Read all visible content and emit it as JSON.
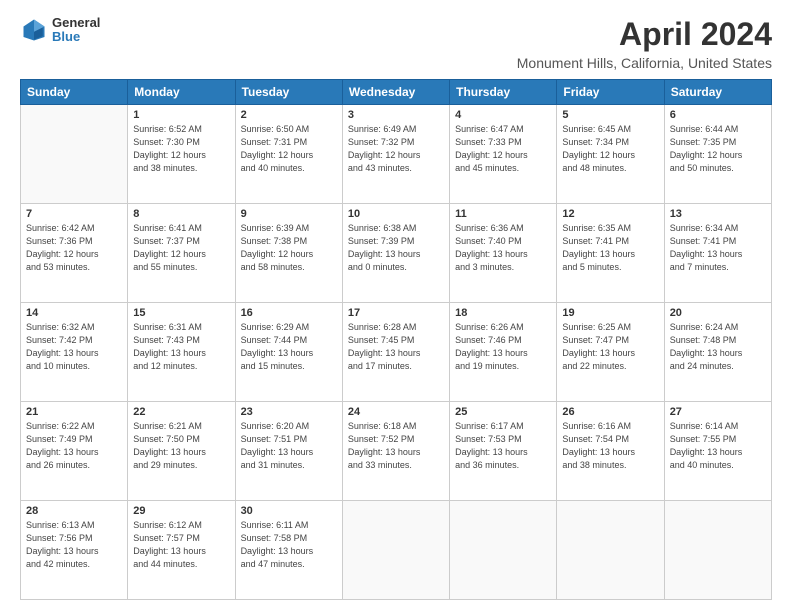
{
  "logo": {
    "general": "General",
    "blue": "Blue"
  },
  "title": "April 2024",
  "subtitle": "Monument Hills, California, United States",
  "days_of_week": [
    "Sunday",
    "Monday",
    "Tuesday",
    "Wednesday",
    "Thursday",
    "Friday",
    "Saturday"
  ],
  "weeks": [
    [
      {
        "day": "",
        "info": ""
      },
      {
        "day": "1",
        "info": "Sunrise: 6:52 AM\nSunset: 7:30 PM\nDaylight: 12 hours\nand 38 minutes."
      },
      {
        "day": "2",
        "info": "Sunrise: 6:50 AM\nSunset: 7:31 PM\nDaylight: 12 hours\nand 40 minutes."
      },
      {
        "day": "3",
        "info": "Sunrise: 6:49 AM\nSunset: 7:32 PM\nDaylight: 12 hours\nand 43 minutes."
      },
      {
        "day": "4",
        "info": "Sunrise: 6:47 AM\nSunset: 7:33 PM\nDaylight: 12 hours\nand 45 minutes."
      },
      {
        "day": "5",
        "info": "Sunrise: 6:45 AM\nSunset: 7:34 PM\nDaylight: 12 hours\nand 48 minutes."
      },
      {
        "day": "6",
        "info": "Sunrise: 6:44 AM\nSunset: 7:35 PM\nDaylight: 12 hours\nand 50 minutes."
      }
    ],
    [
      {
        "day": "7",
        "info": "Sunrise: 6:42 AM\nSunset: 7:36 PM\nDaylight: 12 hours\nand 53 minutes."
      },
      {
        "day": "8",
        "info": "Sunrise: 6:41 AM\nSunset: 7:37 PM\nDaylight: 12 hours\nand 55 minutes."
      },
      {
        "day": "9",
        "info": "Sunrise: 6:39 AM\nSunset: 7:38 PM\nDaylight: 12 hours\nand 58 minutes."
      },
      {
        "day": "10",
        "info": "Sunrise: 6:38 AM\nSunset: 7:39 PM\nDaylight: 13 hours\nand 0 minutes."
      },
      {
        "day": "11",
        "info": "Sunrise: 6:36 AM\nSunset: 7:40 PM\nDaylight: 13 hours\nand 3 minutes."
      },
      {
        "day": "12",
        "info": "Sunrise: 6:35 AM\nSunset: 7:41 PM\nDaylight: 13 hours\nand 5 minutes."
      },
      {
        "day": "13",
        "info": "Sunrise: 6:34 AM\nSunset: 7:41 PM\nDaylight: 13 hours\nand 7 minutes."
      }
    ],
    [
      {
        "day": "14",
        "info": "Sunrise: 6:32 AM\nSunset: 7:42 PM\nDaylight: 13 hours\nand 10 minutes."
      },
      {
        "day": "15",
        "info": "Sunrise: 6:31 AM\nSunset: 7:43 PM\nDaylight: 13 hours\nand 12 minutes."
      },
      {
        "day": "16",
        "info": "Sunrise: 6:29 AM\nSunset: 7:44 PM\nDaylight: 13 hours\nand 15 minutes."
      },
      {
        "day": "17",
        "info": "Sunrise: 6:28 AM\nSunset: 7:45 PM\nDaylight: 13 hours\nand 17 minutes."
      },
      {
        "day": "18",
        "info": "Sunrise: 6:26 AM\nSunset: 7:46 PM\nDaylight: 13 hours\nand 19 minutes."
      },
      {
        "day": "19",
        "info": "Sunrise: 6:25 AM\nSunset: 7:47 PM\nDaylight: 13 hours\nand 22 minutes."
      },
      {
        "day": "20",
        "info": "Sunrise: 6:24 AM\nSunset: 7:48 PM\nDaylight: 13 hours\nand 24 minutes."
      }
    ],
    [
      {
        "day": "21",
        "info": "Sunrise: 6:22 AM\nSunset: 7:49 PM\nDaylight: 13 hours\nand 26 minutes."
      },
      {
        "day": "22",
        "info": "Sunrise: 6:21 AM\nSunset: 7:50 PM\nDaylight: 13 hours\nand 29 minutes."
      },
      {
        "day": "23",
        "info": "Sunrise: 6:20 AM\nSunset: 7:51 PM\nDaylight: 13 hours\nand 31 minutes."
      },
      {
        "day": "24",
        "info": "Sunrise: 6:18 AM\nSunset: 7:52 PM\nDaylight: 13 hours\nand 33 minutes."
      },
      {
        "day": "25",
        "info": "Sunrise: 6:17 AM\nSunset: 7:53 PM\nDaylight: 13 hours\nand 36 minutes."
      },
      {
        "day": "26",
        "info": "Sunrise: 6:16 AM\nSunset: 7:54 PM\nDaylight: 13 hours\nand 38 minutes."
      },
      {
        "day": "27",
        "info": "Sunrise: 6:14 AM\nSunset: 7:55 PM\nDaylight: 13 hours\nand 40 minutes."
      }
    ],
    [
      {
        "day": "28",
        "info": "Sunrise: 6:13 AM\nSunset: 7:56 PM\nDaylight: 13 hours\nand 42 minutes."
      },
      {
        "day": "29",
        "info": "Sunrise: 6:12 AM\nSunset: 7:57 PM\nDaylight: 13 hours\nand 44 minutes."
      },
      {
        "day": "30",
        "info": "Sunrise: 6:11 AM\nSunset: 7:58 PM\nDaylight: 13 hours\nand 47 minutes."
      },
      {
        "day": "",
        "info": ""
      },
      {
        "day": "",
        "info": ""
      },
      {
        "day": "",
        "info": ""
      },
      {
        "day": "",
        "info": ""
      }
    ]
  ]
}
